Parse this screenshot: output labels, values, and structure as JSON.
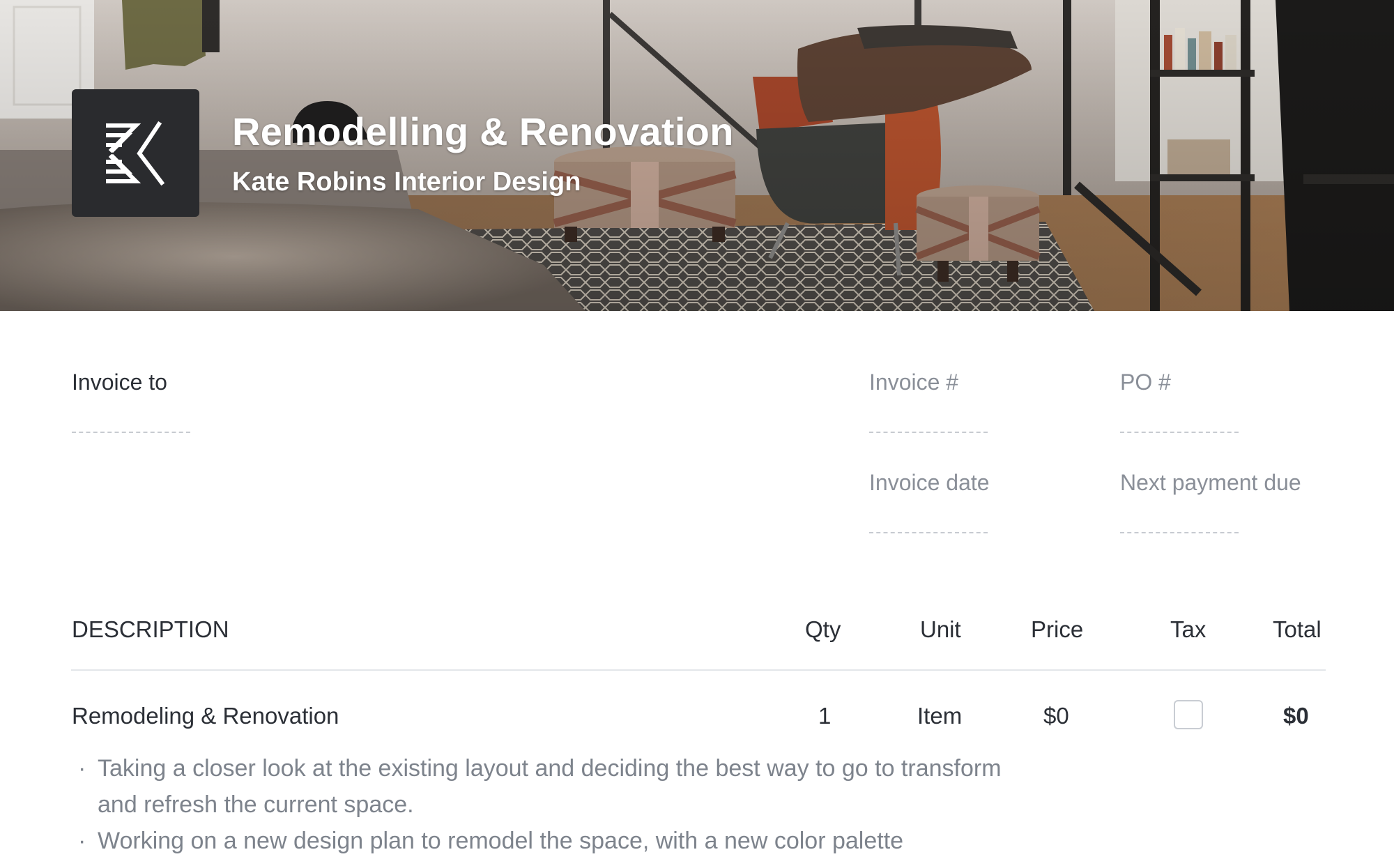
{
  "hero": {
    "title": "Remodelling & Renovation",
    "subtitle": "Kate Robins Interior Design",
    "logo_icon": "k-monogram-logo-icon"
  },
  "invoice_to": {
    "label": "Invoice to",
    "value": ""
  },
  "invoice_number": {
    "label": "Invoice #",
    "value": ""
  },
  "po_number": {
    "label": "PO #",
    "value": ""
  },
  "invoice_date": {
    "label": "Invoice date",
    "value": ""
  },
  "next_payment_due": {
    "label": "Next payment due",
    "value": ""
  },
  "table": {
    "headers": [
      "DESCRIPTION",
      "Qty",
      "Unit",
      "Price",
      "Tax",
      "Total"
    ],
    "rows": [
      {
        "description": "Remodeling & Renovation",
        "qty": "1",
        "unit": "Item",
        "price": "$0",
        "tax_checked": false,
        "total": "$0",
        "notes": [
          "Taking a closer look at the existing layout and deciding the best way to go to transform and refresh the current space.",
          "Working on a new design plan to remodel the space, with a new color palette"
        ]
      }
    ]
  },
  "colors": {
    "text": "#2b2f36",
    "muted": "#8a8f98",
    "logo_tile": "#2a2b2e",
    "rule": "#e3e6ea"
  }
}
